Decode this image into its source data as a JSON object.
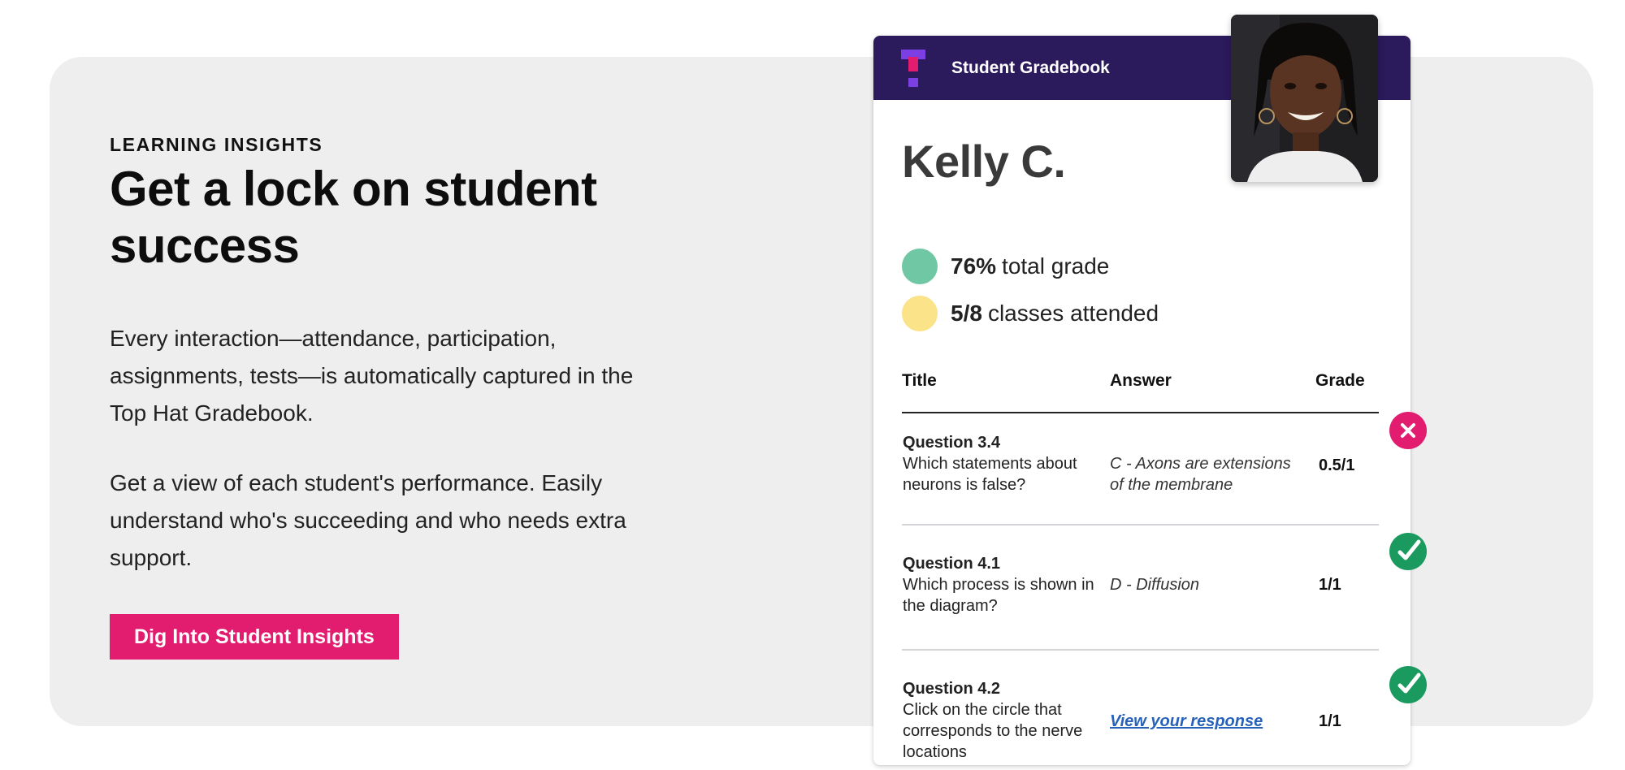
{
  "hero": {
    "eyebrow": "LEARNING INSIGHTS",
    "headline": "Get a lock on student success",
    "paragraph_1": "Every interaction—attendance, participation, assignments, tests—is automatically captured in the Top Hat Gradebook.",
    "paragraph_2": "Get a view of each student's performance. Easily understand who's succeeding and who needs extra support.",
    "cta_label": "Dig Into Student Insights"
  },
  "gradebook": {
    "title": "Student Gradebook",
    "student_name": "Kelly C.",
    "stats": [
      {
        "value": "76%",
        "label": "total grade",
        "color": "#6fc8a3"
      },
      {
        "value": "5/8",
        "label": "classes attended",
        "color": "#fbe38a"
      }
    ],
    "columns": {
      "title": "Title",
      "answer": "Answer",
      "grade": "Grade"
    },
    "rows": [
      {
        "question": "Question 3.4",
        "text": "Which statements about neurons is false?",
        "answer": "C - Axons are extensions of the membrane",
        "grade": "0.5/1",
        "status": "incorrect"
      },
      {
        "question": "Question 4.1",
        "text": "Which process is shown in the diagram?",
        "answer": "D - Diffusion",
        "grade": "1/1",
        "status": "correct"
      },
      {
        "question": "Question 4.2",
        "text": "Click on the circle that corresponds to the nerve locations",
        "answer": "View your response",
        "grade": "1/1",
        "status": "correct"
      }
    ]
  },
  "colors": {
    "accent": "#e21c6e",
    "header": "#2b1a5c",
    "correct": "#1a9a5e",
    "link": "#2761b8"
  },
  "icons": {
    "logo": "top-hat-logo",
    "incorrect": "x-icon",
    "correct": "check-icon"
  }
}
